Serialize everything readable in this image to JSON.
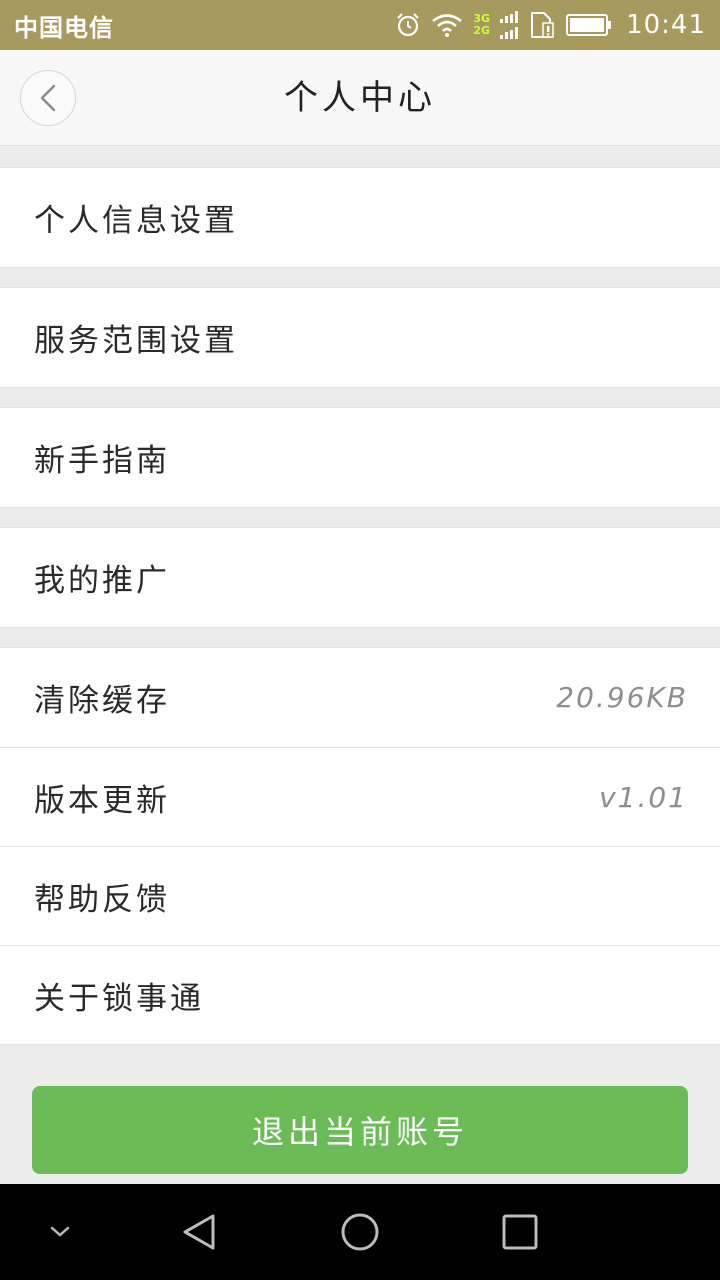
{
  "status_bar": {
    "carrier": "中国电信",
    "network_top": "3G",
    "network_bottom": "2G",
    "time": "10:41",
    "icons": [
      "alarm-icon",
      "wifi-icon",
      "signal-icon",
      "sim-icon",
      "battery-icon"
    ]
  },
  "header": {
    "back_icon": "chevron-left-icon",
    "title": "个人中心"
  },
  "menu": {
    "personal_info": "个人信息设置",
    "service_range": "服务范围设置",
    "beginner_guide": "新手指南",
    "my_promotion": "我的推广",
    "clear_cache": "清除缓存",
    "cache_size": "20.96KB",
    "version_update": "版本更新",
    "version": "v1.01",
    "help_feedback": "帮助反馈",
    "about": "关于锁事通"
  },
  "logout_label": "退出当前账号",
  "colors": {
    "status_bar": "#a89a5e",
    "accent_green": "#6bbc57",
    "background": "#ececec"
  },
  "nav_bar": {
    "icons": [
      "hide-keyboard-icon",
      "back-triangle-icon",
      "home-circle-icon",
      "recents-square-icon"
    ]
  }
}
